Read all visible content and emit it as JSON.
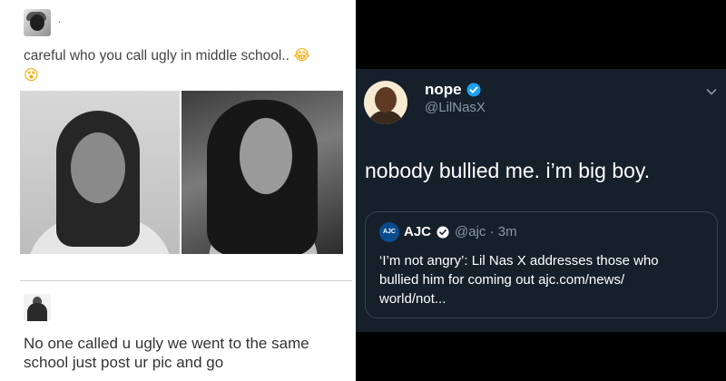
{
  "left_post": {
    "author_mark": ".",
    "text": "careful who you call ugly in middle school..",
    "emoji_laugh": "😂",
    "emoji_dizzy": "😵"
  },
  "reply": {
    "text": "No one called u ugly we went to the same school just post ur pic and go"
  },
  "tweet": {
    "name": "nope",
    "handle": "@LilNasX",
    "body": "nobody bullied me. i’m big boy.",
    "quote": {
      "logo": "AJC",
      "name": "AJC",
      "handle": "@ajc · 3m",
      "text": "‘I’m not angry’: Lil Nas X addresses those who bullied him for coming out ajc.com/news/ world/not..."
    }
  },
  "colors": {
    "tweet_bg": "#15202b",
    "verified_blue": "#1da1f2",
    "secondary_text": "#8899a6"
  },
  "icons": [
    "avatar",
    "verified-badge-icon",
    "chevron-down-icon"
  ]
}
